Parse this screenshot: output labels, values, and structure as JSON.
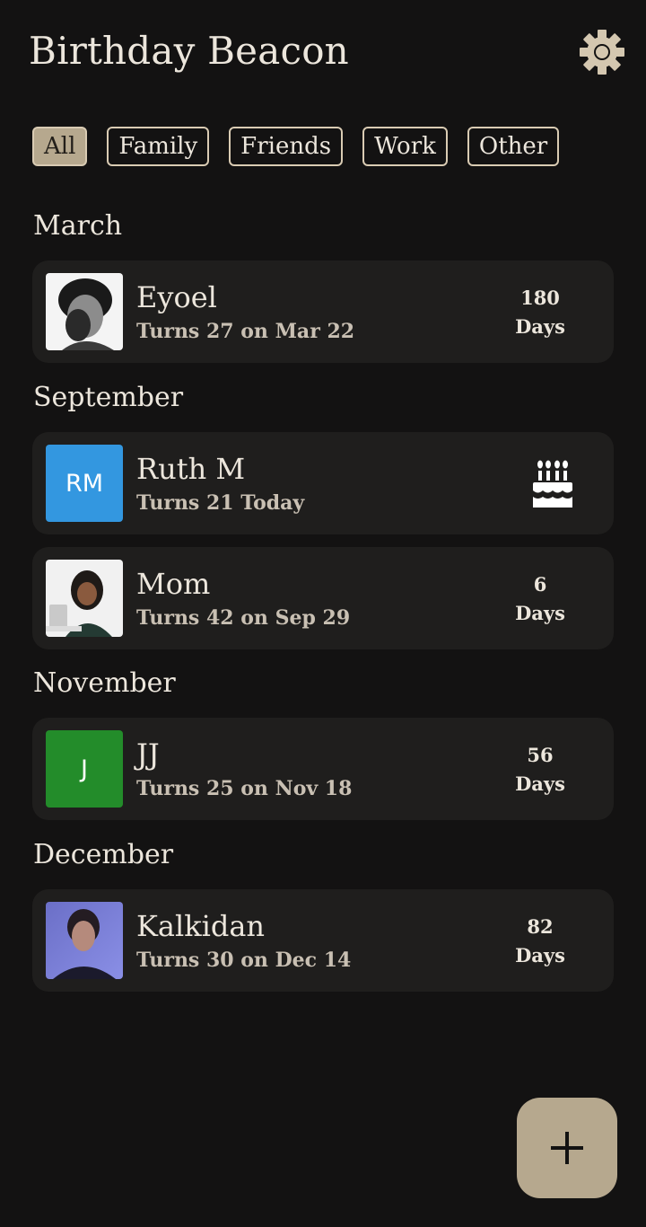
{
  "app": {
    "title": "Birthday Beacon"
  },
  "filters": [
    {
      "label": "All",
      "active": true
    },
    {
      "label": "Family",
      "active": false
    },
    {
      "label": "Friends",
      "active": false
    },
    {
      "label": "Work",
      "active": false
    },
    {
      "label": "Other",
      "active": false
    }
  ],
  "groups": [
    {
      "month": "March",
      "entries": [
        {
          "name": "Eyoel",
          "subtitle": "Turns 27 on Mar 22",
          "days_count": "180",
          "days_label": "Days",
          "avatar": "photo"
        }
      ]
    },
    {
      "month": "September",
      "entries": [
        {
          "name": "Ruth M",
          "subtitle": "Turns 21 Today",
          "avatar": "initials",
          "initials": "RM",
          "avatar_color": "#3397e0",
          "status_icon": "birthday-cake-icon"
        },
        {
          "name": "Mom",
          "subtitle": "Turns 42 on Sep 29",
          "days_count": "6",
          "days_label": "Days",
          "avatar": "photo"
        }
      ]
    },
    {
      "month": "November",
      "entries": [
        {
          "name": "JJ",
          "subtitle": "Turns 25 on Nov 18",
          "days_count": "56",
          "days_label": "Days",
          "avatar": "initials",
          "initials": "J",
          "avatar_color": "#238c2a"
        }
      ]
    },
    {
      "month": "December",
      "entries": [
        {
          "name": "Kalkidan",
          "subtitle": "Turns 30 on Dec 14",
          "days_count": "82",
          "days_label": "Days",
          "avatar": "photo"
        }
      ]
    }
  ],
  "colors": {
    "background": "#131212",
    "card": "#1f1e1d",
    "accent": "#b6a88e",
    "chip_border": "#d9cbb3",
    "text": "#ece6dc"
  },
  "icons": {
    "settings": "gear-icon",
    "add": "plus-icon"
  }
}
